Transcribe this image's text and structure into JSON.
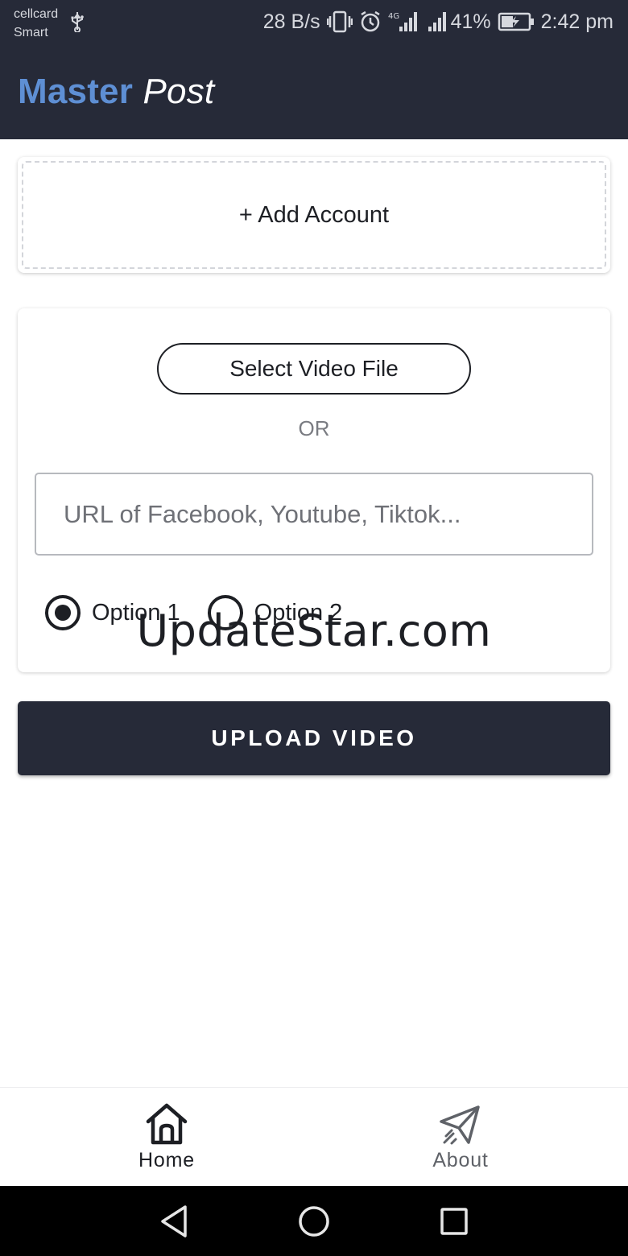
{
  "status_bar": {
    "carrier_line1": "cellcard",
    "carrier_line2": "Smart",
    "net_speed": "28 B/s",
    "network_type": "4G",
    "battery": "41%",
    "time": "2:42 pm"
  },
  "header": {
    "title_brand": "Master",
    "title_suffix": "Post",
    "brand_color": "#5e8fd4",
    "background": "#262a38"
  },
  "add_account": {
    "label": "+ Add Account"
  },
  "upload_card": {
    "select_file_label": "Select Video File",
    "divider_text": "OR",
    "url_placeholder": "URL of Facebook, Youtube, Tiktok...",
    "url_value": "",
    "options": [
      {
        "label": "Option 1",
        "selected": true
      },
      {
        "label": "Option 2",
        "selected": false
      }
    ]
  },
  "watermark": "UpdateStar.com",
  "upload_button_label": "UPLOAD VIDEO",
  "bottom_nav": {
    "tabs": [
      {
        "label": "Home",
        "icon": "home-icon",
        "active": true
      },
      {
        "label": "About",
        "icon": "paper-plane-icon",
        "active": false
      }
    ]
  },
  "system_nav": {
    "buttons": [
      "back-icon",
      "home-circle-icon",
      "recents-icon"
    ]
  }
}
